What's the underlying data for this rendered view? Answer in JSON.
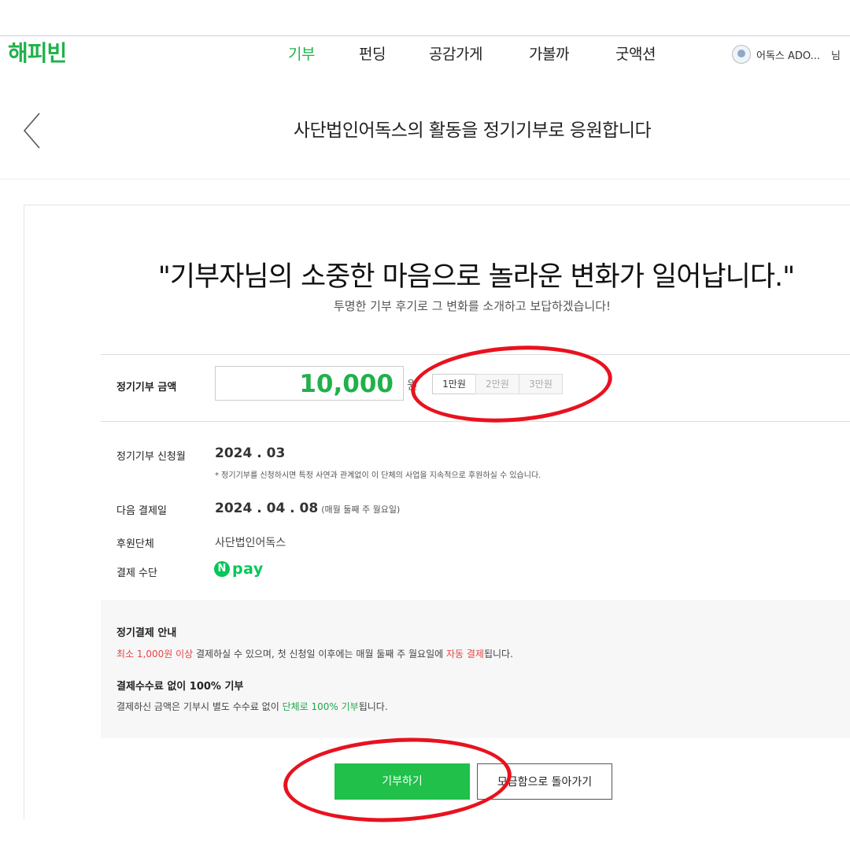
{
  "header": {
    "logo": "해피빈",
    "nav": [
      "기부",
      "펀딩",
      "공감가게",
      "가볼까",
      "굿액션"
    ],
    "active_index": 0,
    "user_name": "어독스 ADO...",
    "user_suffix": "님"
  },
  "page": {
    "title": "사단법인어독스의 활동을 정기기부로 응원합니다"
  },
  "hero": {
    "headline": "\"기부자님의 소중한 마음으로 놀라운 변화가 일어납니다.\"",
    "sub": "투명한 기부 후기로 그 변화를 소개하고 보답하겠습니다!"
  },
  "form": {
    "amount_label": "정기기부 금액",
    "amount_value": "10,000",
    "amount_unit": "원",
    "presets": [
      "1만원",
      "2만원",
      "3만원"
    ],
    "selected_preset": "1만원",
    "apply_month_label": "정기기부 신청월",
    "apply_month": "2024 . 03",
    "apply_note": "* 정기기부를 신청하시면 특정 사연과 관계없이 이 단체의 사업을 지속적으로 후원하실 수 있습니다.",
    "next_pay_label": "다음 결제일",
    "next_pay_date": "2024 . 04 . 08",
    "next_pay_rule": "(매월 둘째 주 월요일)",
    "org_label": "후원단체",
    "org_name": "사단법인어독스",
    "pay_method_label": "결제 수단",
    "pay_method": {
      "mark": "N",
      "text": "pay"
    }
  },
  "notice": {
    "title1": "정기결제 안내",
    "line1": {
      "part1": "최소 1,000원 이상",
      "part2": " 결제하실 수 있으며, 첫 신청일 이후에는 매월 둘째 주 월요일에 ",
      "part3": "자동 결제",
      "part4": "됩니다."
    },
    "title2": "결제수수료 없이 100% 기부",
    "line2": {
      "part1": "결제하신 금액은 기부시 별도 수수료 없이 ",
      "part2": "단체로 100% 기부",
      "part3": "됩니다."
    }
  },
  "buttons": {
    "donate": "기부하기",
    "back": "모금함으로 돌아가기"
  },
  "colors": {
    "brand": "#20b14a",
    "button": "#20c04a",
    "emphasis_red": "#e64545",
    "annotation": "#e8121e"
  }
}
